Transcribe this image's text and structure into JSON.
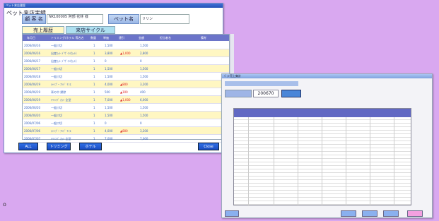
{
  "window1": {
    "titlebar": "ペット来店履歴",
    "heading": "ペット来店実績",
    "fields": {
      "customer_label": "顧 客 名",
      "customer_value": "NK100005 阿部 花林 様",
      "pet_label": "ペット名",
      "pet_value": "リリン"
    },
    "tabs": {
      "sales_history": "売上履歴",
      "visit_cycle": "来店サイクル"
    },
    "table": {
      "columns": [
        "年月日",
        "トリミング/ホテル 等名名",
        "数量",
        "単価",
        "値引",
        "金額",
        "担当者名",
        "備考"
      ],
      "rows": [
        {
          "date": "2006/06/16",
          "item": "一般爪切",
          "qty": "1",
          "price": "1,500",
          "disc": "",
          "amount": "1,500",
          "staff": "",
          "note": ""
        },
        {
          "date": "2006/06/16",
          "item": "出産ｶｯﾄ ﾃﾞｻﾞｲﾝ(ｶｯﾄ)",
          "qty": "1",
          "price": "3,800",
          "disc": "▲1,000",
          "amount": "2,800",
          "staff": "",
          "note": ""
        },
        {
          "date": "2006/06/17",
          "item": "出産ｶｯﾄ ﾃﾞｻﾞｲﾝ(ｶｯﾄ)",
          "qty": "1",
          "price": "0",
          "disc": "",
          "amount": "0",
          "staff": "",
          "note": ""
        },
        {
          "date": "2006/06/17",
          "item": "一般爪切",
          "qty": "1",
          "price": "1,500",
          "disc": "",
          "amount": "1,500",
          "staff": "",
          "note": ""
        },
        {
          "date": "2006/06/18",
          "item": "一般爪切",
          "qty": "1",
          "price": "1,500",
          "disc": "",
          "amount": "1,500",
          "staff": "",
          "note": ""
        },
        {
          "date": "2006/06/19",
          "item": "ｼｬﾝﾌﾟｰ ｱﾝﾄﾞ ﾘﾝｽ",
          "qty": "1",
          "price": "4,000",
          "disc": "▲800",
          "amount": "3,200",
          "staff": "",
          "note": ""
        },
        {
          "date": "2006/06/19",
          "item": "耳の中 掃除",
          "qty": "1",
          "price": "500",
          "disc": "▲100",
          "amount": "400",
          "staff": "",
          "note": ""
        },
        {
          "date": "2006/06/19",
          "item": "ﾄﾘﾐﾝｸﾞ ｶｯﾄ 全型",
          "qty": "1",
          "price": "7,000",
          "disc": "▲1,000",
          "amount": "6,000",
          "staff": "",
          "note": ""
        },
        {
          "date": "2006/06/20",
          "item": "一般爪切",
          "qty": "1",
          "price": "1,500",
          "disc": "",
          "amount": "1,500",
          "staff": "",
          "note": ""
        },
        {
          "date": "2006/06/20",
          "item": "一般爪切",
          "qty": "1",
          "price": "1,500",
          "disc": "",
          "amount": "1,500",
          "staff": "",
          "note": ""
        },
        {
          "date": "2006/07/06",
          "item": "一般爪切",
          "qty": "1",
          "price": "0",
          "disc": "",
          "amount": "0",
          "staff": "",
          "note": ""
        },
        {
          "date": "2006/07/06",
          "item": "ｼｬﾝﾌﾟｰ ｱﾝﾄﾞ ﾘﾝｽ",
          "qty": "1",
          "price": "4,000",
          "disc": "▲800",
          "amount": "3,200",
          "staff": "",
          "note": ""
        },
        {
          "date": "2006/07/07",
          "item": "ﾄﾘﾐﾝｸﾞ ｶｯﾄ 全型",
          "qty": "1",
          "price": "7,000",
          "disc": "",
          "amount": "7,000",
          "staff": "",
          "note": ""
        }
      ]
    },
    "buttons": {
      "all": "ALL",
      "trimming": "トリミング",
      "hotel": "ホテル",
      "close": "Close"
    }
  },
  "window2": {
    "titlebar": "ﾍﾟｯﾄ売上集計",
    "field_value": "200670"
  },
  "footer_glyph": "o"
}
